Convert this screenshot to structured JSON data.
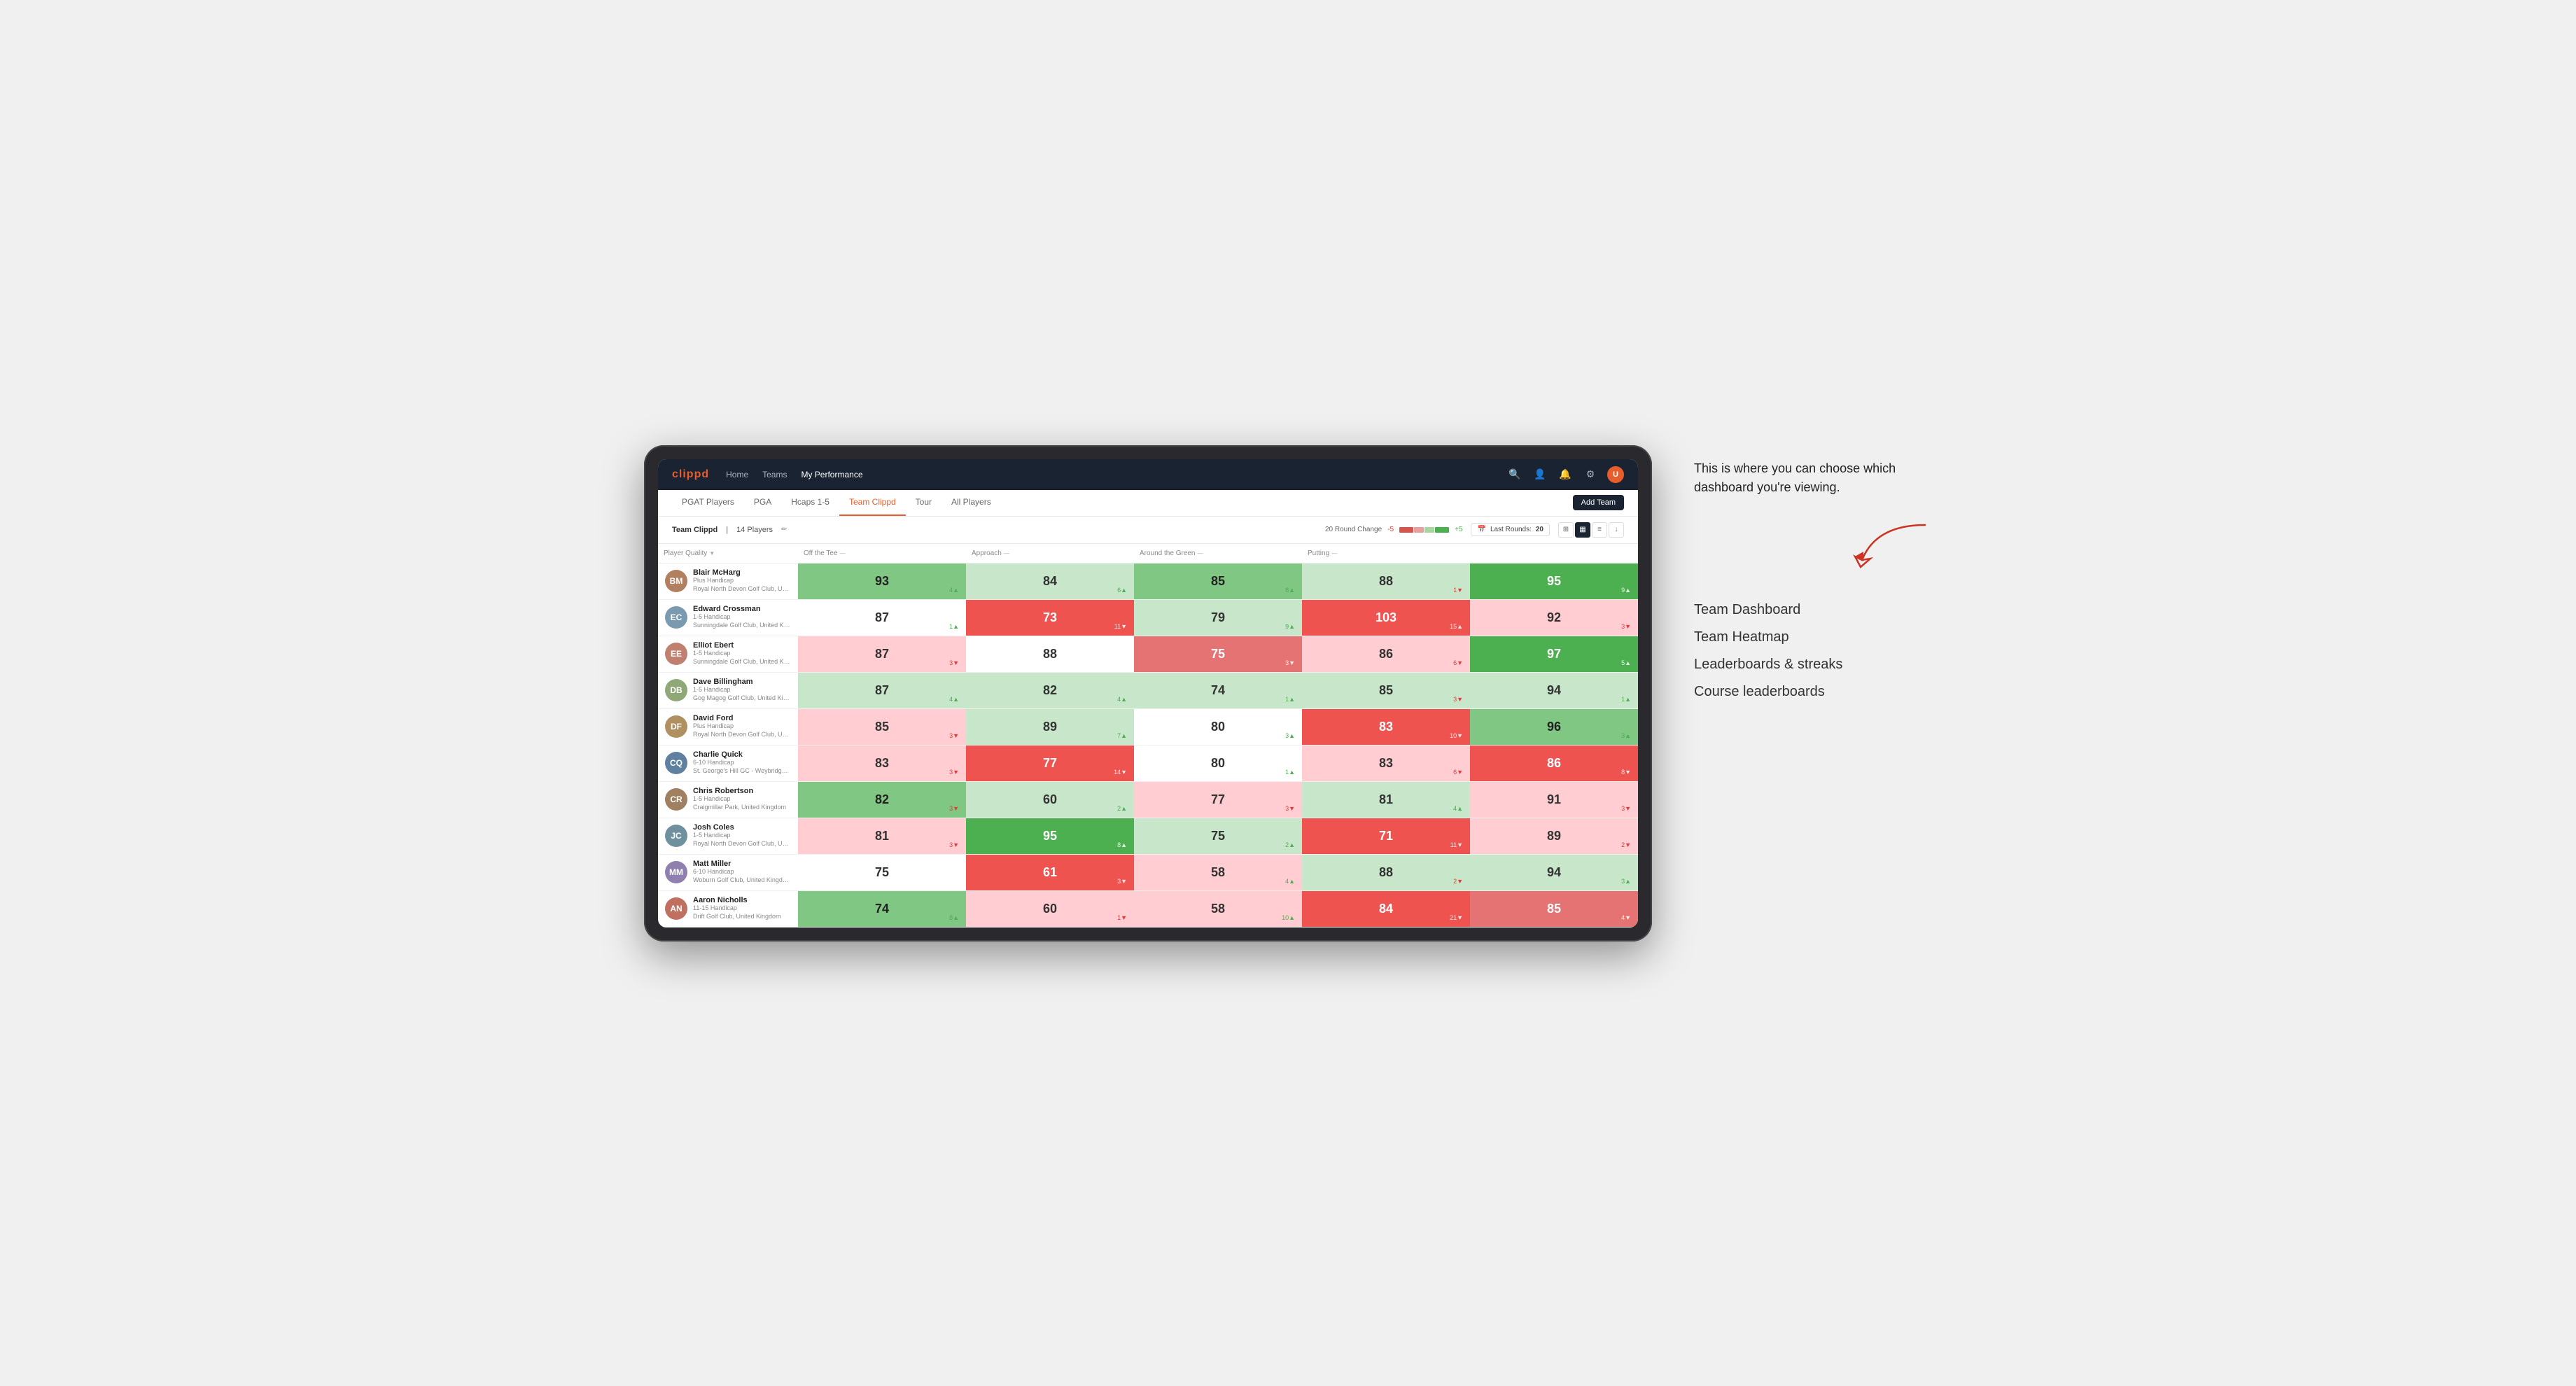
{
  "annotation": {
    "intro_text": "This is where you can choose which dashboard you're viewing.",
    "options": [
      "Team Dashboard",
      "Team Heatmap",
      "Leaderboards & streaks",
      "Course leaderboards"
    ]
  },
  "nav": {
    "logo": "clippd",
    "links": [
      "Home",
      "Teams",
      "My Performance"
    ],
    "active_link": "My Performance"
  },
  "sub_nav": {
    "links": [
      "PGAT Players",
      "PGA",
      "Hcaps 1-5",
      "Team Clippd",
      "Tour",
      "All Players"
    ],
    "active": "Team Clippd",
    "add_team_label": "Add Team"
  },
  "team_header": {
    "name": "Team Clippd",
    "separator": "|",
    "count": "14 Players",
    "round_change_label": "20 Round Change",
    "neg_label": "-5",
    "pos_label": "+5",
    "last_rounds_label": "Last Rounds:",
    "last_rounds_value": "20"
  },
  "columns": {
    "player": "Player Quality",
    "off_tee": "Off the Tee",
    "approach": "Approach",
    "around_green": "Around the Green",
    "putting": "Putting"
  },
  "players": [
    {
      "name": "Blair McHarg",
      "handicap": "Plus Handicap",
      "club": "Royal North Devon Golf Club, United Kingdom",
      "initials": "BM",
      "avatar_color": "#b08060",
      "scores": {
        "player_quality": {
          "value": 93,
          "change": "+4",
          "direction": "up",
          "bg": "bg-green-mid"
        },
        "off_tee": {
          "value": 84,
          "change": "+6",
          "direction": "up",
          "bg": "bg-green-light"
        },
        "approach": {
          "value": 85,
          "change": "+8",
          "direction": "up",
          "bg": "bg-green-mid"
        },
        "around_green": {
          "value": 88,
          "change": "-1",
          "direction": "down",
          "bg": "bg-green-light"
        },
        "putting": {
          "value": 95,
          "change": "+9",
          "direction": "up",
          "bg": "bg-green"
        }
      }
    },
    {
      "name": "Edward Crossman",
      "handicap": "1-5 Handicap",
      "club": "Sunningdale Golf Club, United Kingdom",
      "initials": "EC",
      "avatar_color": "#7a9ab0",
      "scores": {
        "player_quality": {
          "value": 87,
          "change": "+1",
          "direction": "up",
          "bg": "bg-white"
        },
        "off_tee": {
          "value": 73,
          "change": "-11",
          "direction": "down",
          "bg": "bg-red"
        },
        "approach": {
          "value": 79,
          "change": "+9",
          "direction": "up",
          "bg": "bg-green-light"
        },
        "around_green": {
          "value": 103,
          "change": "+15",
          "direction": "up",
          "bg": "bg-red"
        },
        "putting": {
          "value": 92,
          "change": "-3",
          "direction": "down",
          "bg": "bg-red-light"
        }
      }
    },
    {
      "name": "Elliot Ebert",
      "handicap": "1-5 Handicap",
      "club": "Sunningdale Golf Club, United Kingdom",
      "initials": "EE",
      "avatar_color": "#c08070",
      "scores": {
        "player_quality": {
          "value": 87,
          "change": "-3",
          "direction": "down",
          "bg": "bg-red-light"
        },
        "off_tee": {
          "value": 88,
          "change": "",
          "direction": "",
          "bg": "bg-white"
        },
        "approach": {
          "value": 75,
          "change": "-3",
          "direction": "down",
          "bg": "bg-red-mid"
        },
        "around_green": {
          "value": 86,
          "change": "-6",
          "direction": "down",
          "bg": "bg-red-light"
        },
        "putting": {
          "value": 97,
          "change": "+5",
          "direction": "up",
          "bg": "bg-green"
        }
      }
    },
    {
      "name": "Dave Billingham",
      "handicap": "1-5 Handicap",
      "club": "Gog Magog Golf Club, United Kingdom",
      "initials": "DB",
      "avatar_color": "#90a878",
      "scores": {
        "player_quality": {
          "value": 87,
          "change": "+4",
          "direction": "up",
          "bg": "bg-green-light"
        },
        "off_tee": {
          "value": 82,
          "change": "+4",
          "direction": "up",
          "bg": "bg-green-light"
        },
        "approach": {
          "value": 74,
          "change": "+1",
          "direction": "up",
          "bg": "bg-green-light"
        },
        "around_green": {
          "value": 85,
          "change": "-3",
          "direction": "down",
          "bg": "bg-green-light"
        },
        "putting": {
          "value": 94,
          "change": "+1",
          "direction": "up",
          "bg": "bg-green-light"
        }
      }
    },
    {
      "name": "David Ford",
      "handicap": "Plus Handicap",
      "club": "Royal North Devon Golf Club, United Kingdom",
      "initials": "DF",
      "avatar_color": "#b09060",
      "scores": {
        "player_quality": {
          "value": 85,
          "change": "-3",
          "direction": "down",
          "bg": "bg-red-light"
        },
        "off_tee": {
          "value": 89,
          "change": "+7",
          "direction": "up",
          "bg": "bg-green-light"
        },
        "approach": {
          "value": 80,
          "change": "+3",
          "direction": "up",
          "bg": "bg-white"
        },
        "around_green": {
          "value": 83,
          "change": "-10",
          "direction": "down",
          "bg": "bg-red"
        },
        "putting": {
          "value": 96,
          "change": "+3",
          "direction": "up",
          "bg": "bg-green-mid"
        }
      }
    },
    {
      "name": "Charlie Quick",
      "handicap": "6-10 Handicap",
      "club": "St. George's Hill GC - Weybridge - Surrey, Uni...",
      "initials": "CQ",
      "avatar_color": "#6080a0",
      "scores": {
        "player_quality": {
          "value": 83,
          "change": "-3",
          "direction": "down",
          "bg": "bg-red-light"
        },
        "off_tee": {
          "value": 77,
          "change": "-14",
          "direction": "down",
          "bg": "bg-red"
        },
        "approach": {
          "value": 80,
          "change": "+1",
          "direction": "up",
          "bg": "bg-white"
        },
        "around_green": {
          "value": 83,
          "change": "-6",
          "direction": "down",
          "bg": "bg-red-light"
        },
        "putting": {
          "value": 86,
          "change": "-8",
          "direction": "down",
          "bg": "bg-red"
        }
      }
    },
    {
      "name": "Chris Robertson",
      "handicap": "1-5 Handicap",
      "club": "Craigmillar Park, United Kingdom",
      "initials": "CR",
      "avatar_color": "#a08060",
      "scores": {
        "player_quality": {
          "value": 82,
          "change": "-3",
          "direction": "down",
          "bg": "bg-green-mid"
        },
        "off_tee": {
          "value": 60,
          "change": "+2",
          "direction": "up",
          "bg": "bg-green-light"
        },
        "approach": {
          "value": 77,
          "change": "-3",
          "direction": "down",
          "bg": "bg-red-light"
        },
        "around_green": {
          "value": 81,
          "change": "+4",
          "direction": "up",
          "bg": "bg-green-light"
        },
        "putting": {
          "value": 91,
          "change": "-3",
          "direction": "down",
          "bg": "bg-red-light"
        }
      }
    },
    {
      "name": "Josh Coles",
      "handicap": "1-5 Handicap",
      "club": "Royal North Devon Golf Club, United Kingdom",
      "initials": "JC",
      "avatar_color": "#7090a0",
      "scores": {
        "player_quality": {
          "value": 81,
          "change": "-3",
          "direction": "down",
          "bg": "bg-red-light"
        },
        "off_tee": {
          "value": 95,
          "change": "+8",
          "direction": "up",
          "bg": "bg-green"
        },
        "approach": {
          "value": 75,
          "change": "+2",
          "direction": "up",
          "bg": "bg-green-light"
        },
        "around_green": {
          "value": 71,
          "change": "-11",
          "direction": "down",
          "bg": "bg-red"
        },
        "putting": {
          "value": 89,
          "change": "-2",
          "direction": "down",
          "bg": "bg-red-light"
        }
      }
    },
    {
      "name": "Matt Miller",
      "handicap": "6-10 Handicap",
      "club": "Woburn Golf Club, United Kingdom",
      "initials": "MM",
      "avatar_color": "#9080b0",
      "scores": {
        "player_quality": {
          "value": 75,
          "change": "",
          "direction": "",
          "bg": "bg-white"
        },
        "off_tee": {
          "value": 61,
          "change": "-3",
          "direction": "down",
          "bg": "bg-red"
        },
        "approach": {
          "value": 58,
          "change": "+4",
          "direction": "up",
          "bg": "bg-red-light"
        },
        "around_green": {
          "value": 88,
          "change": "-2",
          "direction": "down",
          "bg": "bg-green-light"
        },
        "putting": {
          "value": 94,
          "change": "+3",
          "direction": "up",
          "bg": "bg-green-light"
        }
      }
    },
    {
      "name": "Aaron Nicholls",
      "handicap": "11-15 Handicap",
      "club": "Drift Golf Club, United Kingdom",
      "initials": "AN",
      "avatar_color": "#c07060",
      "scores": {
        "player_quality": {
          "value": 74,
          "change": "+8",
          "direction": "up",
          "bg": "bg-green-mid"
        },
        "off_tee": {
          "value": 60,
          "change": "-1",
          "direction": "down",
          "bg": "bg-red-light"
        },
        "approach": {
          "value": 58,
          "change": "+10",
          "direction": "up",
          "bg": "bg-red-light"
        },
        "around_green": {
          "value": 84,
          "change": "-21",
          "direction": "down",
          "bg": "bg-red"
        },
        "putting": {
          "value": 85,
          "change": "-4",
          "direction": "down",
          "bg": "bg-red-mid"
        }
      }
    }
  ]
}
